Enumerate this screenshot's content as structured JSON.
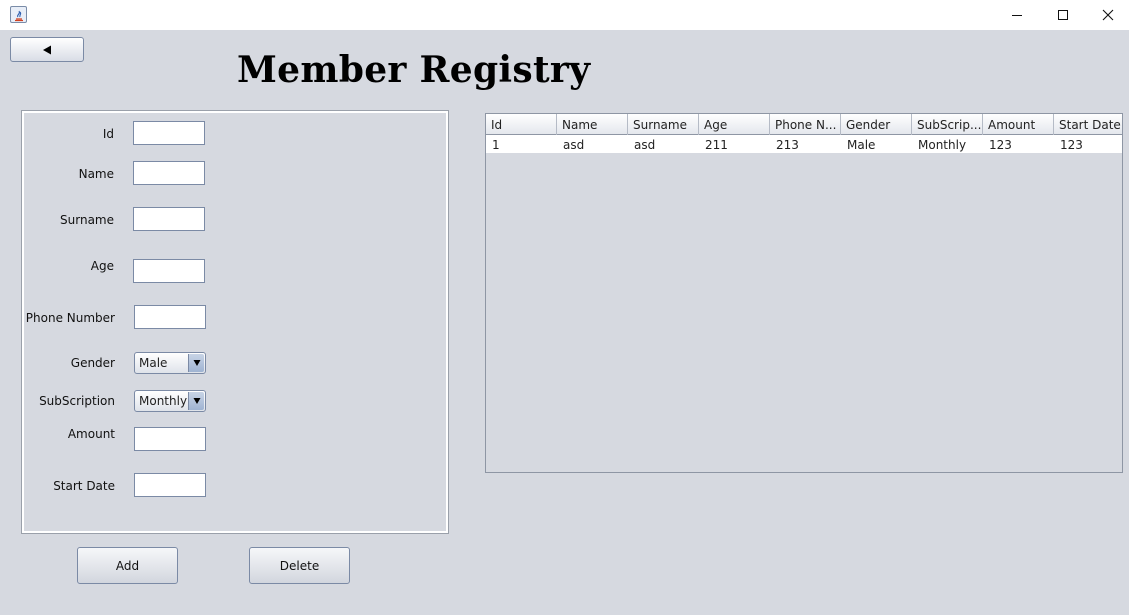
{
  "window": {
    "minimize_icon": "minimize-icon",
    "maximize_icon": "maximize-icon",
    "close_icon": "close-icon",
    "app_icon": "java-app-icon"
  },
  "nav": {
    "back_icon": "back-arrow-icon"
  },
  "page": {
    "title": "Member Registry"
  },
  "form": {
    "id_label": "Id",
    "name_label": "Name",
    "surname_label": "Surname",
    "age_label": "Age",
    "phone_label": "Phone Number",
    "gender_label": "Gender",
    "gender_value": "Male",
    "subscription_label": "SubScription",
    "subscription_value": "Monthly",
    "amount_label": "Amount",
    "start_date_label": "Start Date",
    "id_value": "",
    "name_value": "",
    "surname_value": "",
    "age_value": "",
    "phone_value": "",
    "amount_value": "",
    "start_date_value": ""
  },
  "actions": {
    "add_label": "Add",
    "delete_label": "Delete"
  },
  "table": {
    "columns": [
      "Id",
      "Name",
      "Surname",
      "Age",
      "Phone N...",
      "Gender",
      "SubScrip...",
      "Amount",
      "Start Date"
    ],
    "rows": [
      [
        "1",
        "asd",
        "asd",
        "211",
        "213",
        "Male",
        "Monthly",
        "123",
        "123"
      ]
    ]
  }
}
